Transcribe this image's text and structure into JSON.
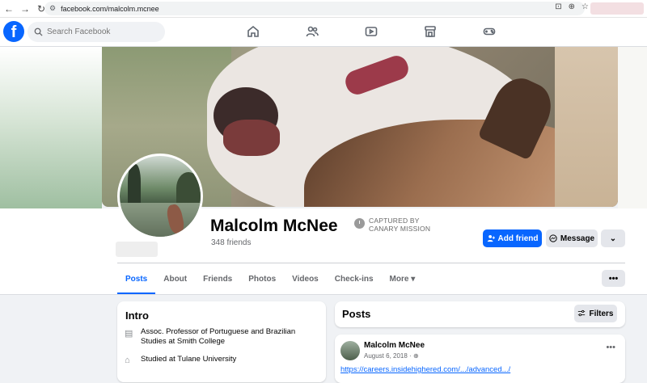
{
  "browser": {
    "url": "facebook.com/malcolm.mcnee"
  },
  "header": {
    "logo": "f",
    "search_placeholder": "Search Facebook",
    "nav_icons": [
      "home-icon",
      "friends-icon",
      "watch-icon",
      "marketplace-icon",
      "gaming-icon"
    ]
  },
  "profile": {
    "name": "Malcolm McNee",
    "friends": "348 friends",
    "canary_line1": "CAPTURED BY",
    "canary_line2": "CANARY MISSION",
    "add_friend_label": "Add friend",
    "message_label": "Message",
    "more_chevron": "⌄",
    "dots": "•••"
  },
  "tabs": [
    {
      "label": "Posts"
    },
    {
      "label": "About"
    },
    {
      "label": "Friends"
    },
    {
      "label": "Photos"
    },
    {
      "label": "Videos"
    },
    {
      "label": "Check-ins"
    },
    {
      "label": "More ▾"
    }
  ],
  "intro": {
    "title": "Intro",
    "items": [
      {
        "icon": "work-icon",
        "text": "Assoc. Professor of Portuguese and Brazilian Studies at Smith College"
      },
      {
        "icon": "education-icon",
        "text": "Studied at Tulane University"
      }
    ]
  },
  "posts": {
    "title": "Posts",
    "filters_label": "Filters",
    "post": {
      "author": "Malcolm McNee",
      "date": "August 6, 2018 · ",
      "link": "https://careers.insidehighered.com/.../advanced.../",
      "dots": "•••"
    }
  },
  "colors": {
    "accent": "#0866ff",
    "background": "#f0f2f5"
  }
}
